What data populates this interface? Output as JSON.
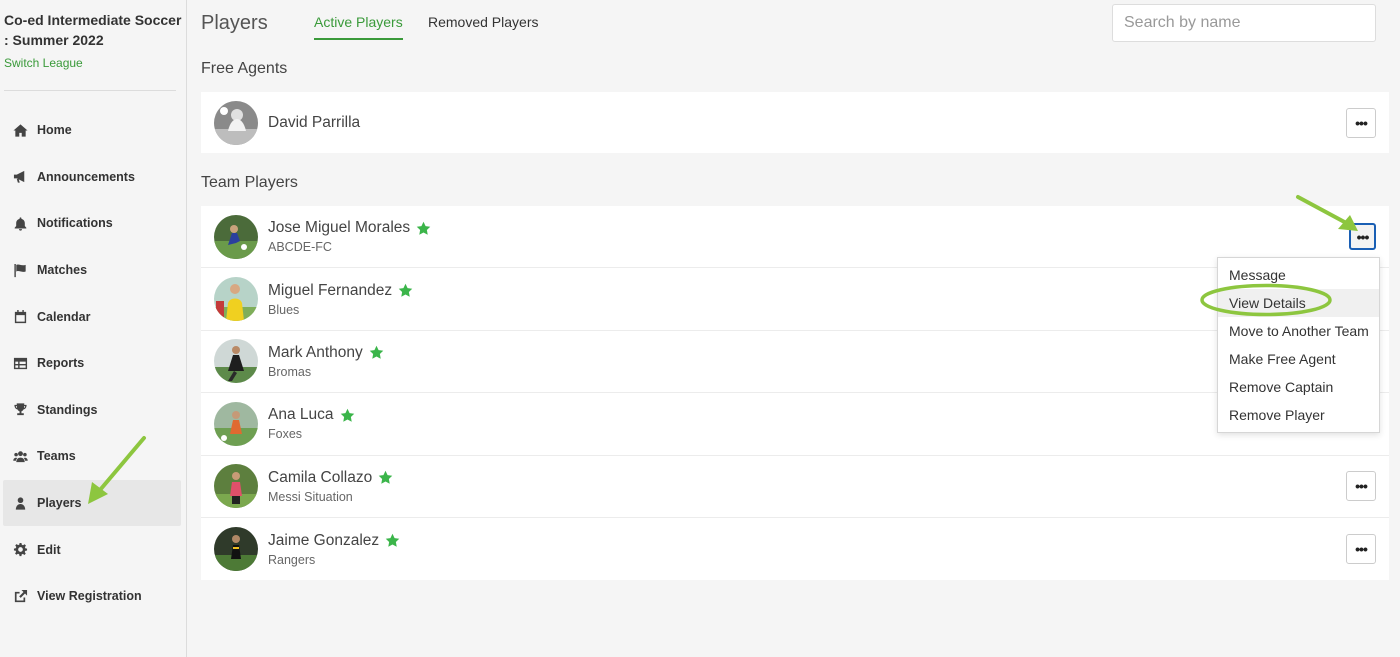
{
  "league": {
    "title": "Co-ed Intermediate Soccer : Summer 2022",
    "switch_label": "Switch League"
  },
  "sidebar": {
    "items": [
      {
        "label": "Home",
        "icon": "home-icon"
      },
      {
        "label": "Announcements",
        "icon": "megaphone-icon"
      },
      {
        "label": "Notifications",
        "icon": "bell-icon"
      },
      {
        "label": "Matches",
        "icon": "flag-icon"
      },
      {
        "label": "Calendar",
        "icon": "calendar-icon"
      },
      {
        "label": "Reports",
        "icon": "table-icon"
      },
      {
        "label": "Standings",
        "icon": "trophy-icon"
      },
      {
        "label": "Teams",
        "icon": "users-icon"
      },
      {
        "label": "Players",
        "icon": "user-icon",
        "active": true
      },
      {
        "label": "Edit",
        "icon": "gear-icon"
      },
      {
        "label": "View Registration",
        "icon": "external-link-icon"
      }
    ]
  },
  "header": {
    "title": "Players",
    "tabs": [
      {
        "label": "Active Players",
        "active": true
      },
      {
        "label": "Removed Players"
      }
    ],
    "search_placeholder": "Search by name"
  },
  "free_agents": {
    "heading": "Free Agents",
    "players": [
      {
        "name": "David Parrilla"
      }
    ]
  },
  "team_players": {
    "heading": "Team Players",
    "players": [
      {
        "name": "Jose Miguel Morales",
        "team": "ABCDE-FC",
        "captain": true
      },
      {
        "name": "Miguel Fernandez",
        "team": "Blues",
        "captain": true
      },
      {
        "name": "Mark Anthony",
        "team": "Bromas",
        "captain": true
      },
      {
        "name": "Ana Luca",
        "team": "Foxes",
        "captain": true
      },
      {
        "name": "Camila Collazo",
        "team": "Messi Situation",
        "captain": true
      },
      {
        "name": "Jaime Gonzalez",
        "team": "Rangers",
        "captain": true
      }
    ]
  },
  "more_button_label": "•••",
  "dropdown": {
    "items": [
      "Message",
      "View Details",
      "Move to Another Team",
      "Make Free Agent",
      "Remove Captain",
      "Remove Player"
    ],
    "highlighted": "View Details"
  },
  "colors": {
    "accent": "#3a9a3a",
    "star": "#3bb54a",
    "annotation": "#8dc63f",
    "focus": "#1a5fb4"
  }
}
